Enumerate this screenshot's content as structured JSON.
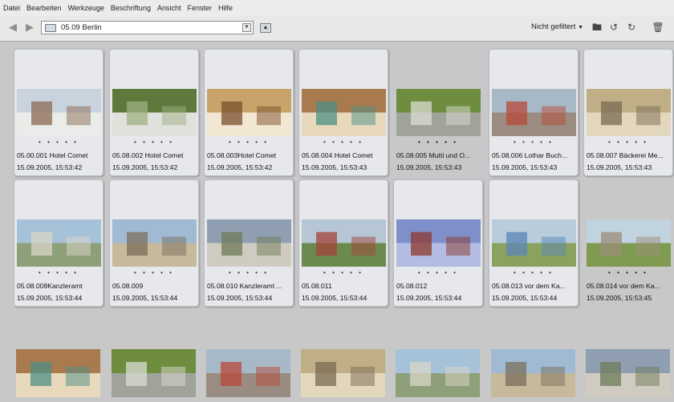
{
  "menu": [
    "Datei",
    "Bearbeiten",
    "Werkzeuge",
    "Beschriftung",
    "Ansicht",
    "Fenster",
    "Hilfe"
  ],
  "path": {
    "value": "05.09 Berlin"
  },
  "filter": {
    "label": "Nicht gefiltert"
  },
  "colors": {
    "card_bg": "#e6e8ec",
    "grid_bg": "#c8c8c8",
    "toolbar_bg": "#e8e8e8"
  },
  "rating_dots": "• • • • •",
  "rows": [
    [
      {
        "title": "05.00.001 Hotel Comet",
        "date": "15.09.2005, 15:53:42",
        "selected": true
      },
      {
        "title": "05.08.002 Hotel Comet",
        "date": "15.09.2005, 15:53:42",
        "selected": true
      },
      {
        "title": "05.08.003Hotel Comet",
        "date": "15.09.2005, 15:53:42",
        "selected": true
      },
      {
        "title": "05.08.004 Hotel Comet",
        "date": "15.09.2005, 15:53:43",
        "selected": true
      },
      {
        "title": "05.08.005 Mutti und O...",
        "date": "15.09.2005, 15:53:43",
        "selected": false
      },
      {
        "title": "05.08.006 Lothar Buch...",
        "date": "15.09.2005, 15:53:43",
        "selected": true
      },
      {
        "title": "05.08.007 Bäckerei Me...",
        "date": "15.09.2005, 15:53:43",
        "selected": true
      }
    ],
    [
      {
        "title": "05.08.008Kanzleramt",
        "date": "15.09.2005, 15:53:44",
        "selected": true
      },
      {
        "title": "05.08.009",
        "date": "15.09.2005, 15:53:44",
        "selected": true
      },
      {
        "title": "05.08.010 Kanzleramt ...",
        "date": "15.09.2005, 15:53:44",
        "selected": true
      },
      {
        "title": "05.08.011",
        "date": "15.09.2005, 15:53:44",
        "selected": true
      },
      {
        "title": "05.08.012",
        "date": "15.09.2005, 15:53:44",
        "selected": true
      },
      {
        "title": "05.08.013 vor dem Ka...",
        "date": "15.09.2005, 15:53:44",
        "selected": true
      },
      {
        "title": "05.08.014 vor dem Ka...",
        "date": "15.09.2005, 15:53:45",
        "selected": false
      }
    ]
  ],
  "bottom_row_count": 7
}
